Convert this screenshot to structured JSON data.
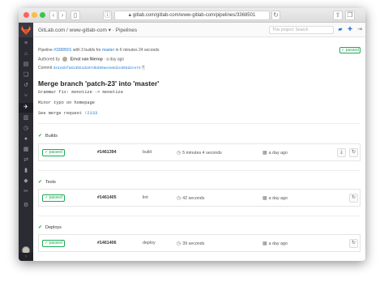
{
  "browser": {
    "url": "gitlab.com/gitlab-com/www-gitlab-com/pipelines/3368501",
    "lock_icon": "lock-icon"
  },
  "header": {
    "title": "GitLab.com / www-gitlab-com ▾ · Pipelines",
    "search_placeholder": "This project: Search"
  },
  "pipeline": {
    "prefix": "Pipeline",
    "id": "#3368501",
    "builds_text": "with 3 builds for",
    "branch": "master",
    "duration_text": "in 6 minutes 24 seconds",
    "status": "passed",
    "authored_label": "Authored by",
    "author": "Ernst van Nierop",
    "authored_time": "· a day ago",
    "commit_label": "Commit",
    "commit_sha": "3e1e2bfa813b51d287d8d89ae4e8d2c855d2ce74"
  },
  "commit": {
    "title": "Merge branch 'patch-23' into 'master'",
    "line1": "Grammar fix: monotize -> monetize",
    "line2": "Minor typo on homepage",
    "line3_prefix": "See merge request",
    "line3_link": "!2133"
  },
  "stages": [
    {
      "name": "Builds",
      "job": {
        "status": "passed",
        "id": "#1461394",
        "name": "build",
        "duration": "5 minutes 4 seconds",
        "finished": "a day ago"
      }
    },
    {
      "name": "Tests",
      "job": {
        "status": "passed",
        "id": "#1461405",
        "name": "lint",
        "duration": "42 seconds",
        "finished": "a day ago"
      }
    },
    {
      "name": "Deploys",
      "job": {
        "status": "passed",
        "id": "#1461406",
        "name": "deploy",
        "duration": "39 seconds",
        "finished": "a day ago"
      }
    }
  ],
  "colors": {
    "success": "#1aaa55",
    "link": "#1f78d1",
    "sidebar": "#2b2b33",
    "logo": "#fc6d26"
  }
}
